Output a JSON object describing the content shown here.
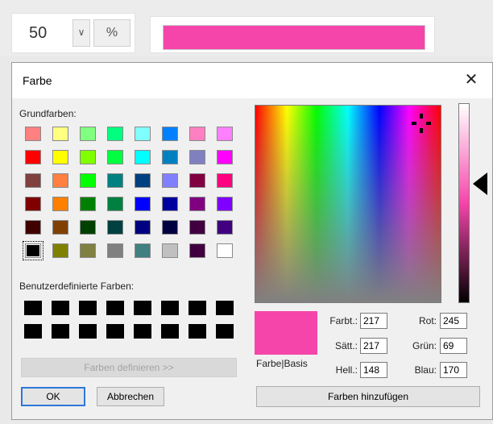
{
  "toolbar": {
    "zoom_value": "50",
    "dropdown_icon": "chevron-down",
    "percent_label": "%",
    "current_color": "#f545aa"
  },
  "dialog": {
    "title": "Farbe",
    "close_icon": "close-x",
    "basic_colors_label": "Grundfarben:",
    "basic_colors": [
      [
        "#ff8080",
        "#ffff80",
        "#80ff80",
        "#00ff80",
        "#80ffff",
        "#0080ff",
        "#ff80c0",
        "#ff80ff"
      ],
      [
        "#ff0000",
        "#ffff00",
        "#80ff00",
        "#00ff40",
        "#00ffff",
        "#0080c0",
        "#8080c0",
        "#ff00ff"
      ],
      [
        "#804040",
        "#ff8040",
        "#00ff00",
        "#008080",
        "#004080",
        "#8080ff",
        "#800040",
        "#ff0080"
      ],
      [
        "#800000",
        "#ff8000",
        "#008000",
        "#008040",
        "#0000ff",
        "#0000a0",
        "#800080",
        "#8000ff"
      ],
      [
        "#400000",
        "#804000",
        "#004000",
        "#004040",
        "#000080",
        "#000040",
        "#400040",
        "#400080"
      ],
      [
        "#000000",
        "#808000",
        "#808040",
        "#808080",
        "#408080",
        "#c0c0c0",
        "#400040",
        "#ffffff"
      ]
    ],
    "selected_basic": [
      5,
      0
    ],
    "custom_colors_label": "Benutzerdefinierte Farben:",
    "custom_colors": [
      [
        "#000000",
        "#000000",
        "#000000",
        "#000000",
        "#000000",
        "#000000",
        "#000000",
        "#000000"
      ],
      [
        "#000000",
        "#000000",
        "#000000",
        "#000000",
        "#000000",
        "#000000",
        "#000000",
        "#000000"
      ]
    ],
    "define_colors_label": "Farben definieren >>",
    "ok_label": "OK",
    "cancel_label": "Abbrechen",
    "preview_label": "Farbe|Basis",
    "preview_color": "#f545aa",
    "hue_label": "Farbt.:",
    "hue_value": "217",
    "sat_label": "Sätt.:",
    "sat_value": "217",
    "lum_label": "Hell.:",
    "lum_value": "148",
    "red_label": "Rot:",
    "red_value": "245",
    "green_label": "Grün:",
    "green_value": "69",
    "blue_label": "Blau:",
    "blue_value": "170",
    "add_colors_label": "Farben hinzufügen"
  }
}
